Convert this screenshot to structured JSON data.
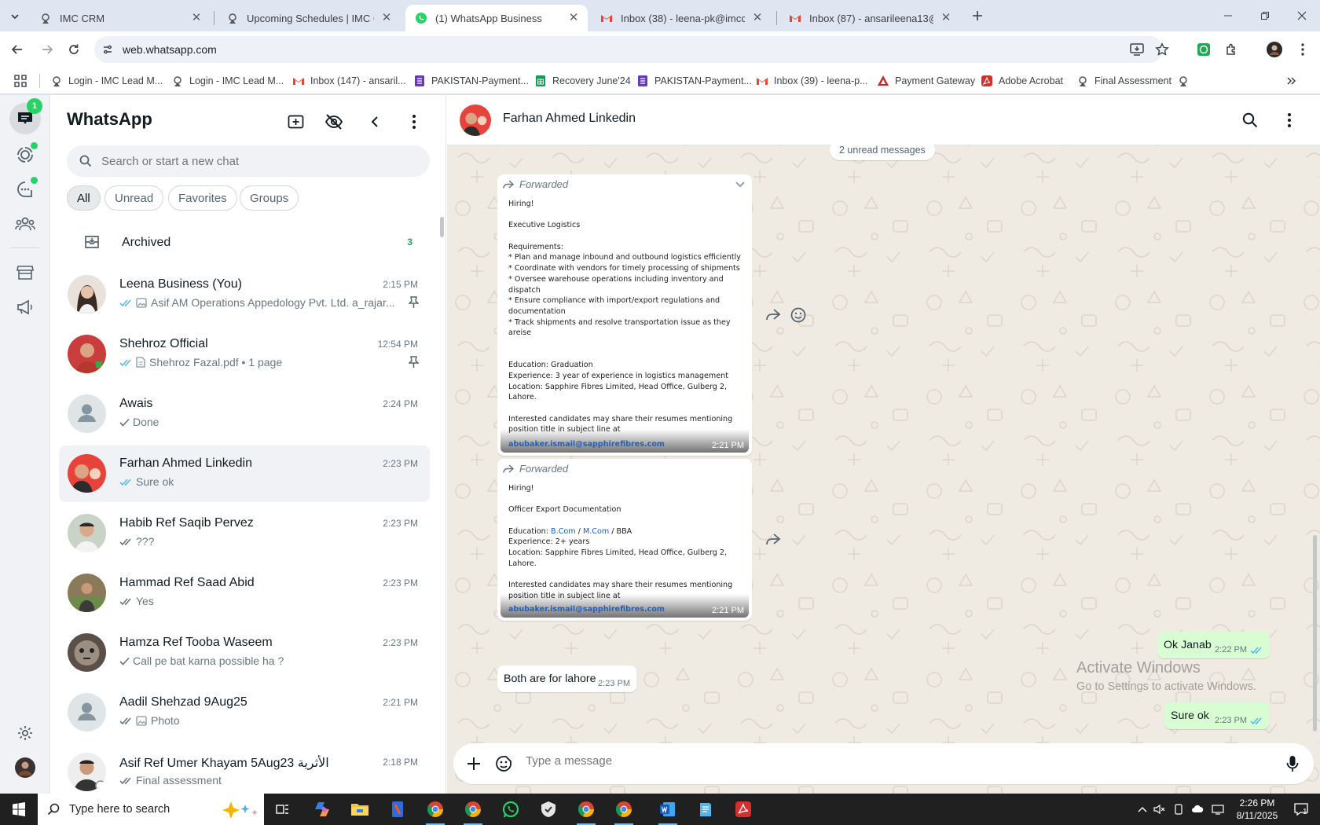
{
  "browser": {
    "tabs": [
      {
        "title": "IMC CRM",
        "active": false
      },
      {
        "title": "Upcoming Schedules | IMC Cer",
        "active": false
      },
      {
        "title": "(1) WhatsApp Business",
        "active": true
      },
      {
        "title": "Inbox (38) - leena-pk@imccerti",
        "active": false
      },
      {
        "title": "Inbox (87) - ansarileena13@gm",
        "active": false
      }
    ],
    "url": "web.whatsapp.com",
    "bookmarks": [
      "Login - IMC Lead M...",
      "Login - IMC Lead M...",
      "Inbox (147) - ansaril...",
      "PAKISTAN-Payment...",
      "Recovery June'24",
      "PAKISTAN-Payment...",
      "Inbox (39) - leena-p...",
      "Payment Gateway",
      "Adobe Acrobat",
      "Final Assessment"
    ]
  },
  "rail": {
    "chats_badge": "1"
  },
  "sidebar": {
    "title": "WhatsApp",
    "search_placeholder": "Search or start a new chat",
    "filters": [
      "All",
      "Unread",
      "Favorites",
      "Groups"
    ],
    "archived_label": "Archived",
    "archived_count": "3",
    "chats": [
      {
        "name": "Leena Business (You)",
        "time": "2:15 PM",
        "preview": "Asif AM Operations Appedology Pvt. Ltd. a_rajar...",
        "tick": "double",
        "media": "photo",
        "pinned": true
      },
      {
        "name": "Shehroz Official",
        "time": "12:54 PM",
        "preview": "Shehroz Fazal.pdf • 1 page",
        "tick": "double",
        "media": "doc",
        "pinned": true
      },
      {
        "name": "Awais",
        "time": "2:24 PM",
        "preview": "Done",
        "tick": "single",
        "media": "",
        "pinned": false
      },
      {
        "name": "Farhan Ahmed Linkedin",
        "time": "2:23 PM",
        "preview": "Sure ok",
        "tick": "double-blue",
        "media": "",
        "pinned": false
      },
      {
        "name": "Habib Ref Saqib Pervez",
        "time": "2:23 PM",
        "preview": "???",
        "tick": "double",
        "media": "",
        "pinned": false
      },
      {
        "name": "Hammad Ref Saad Abid",
        "time": "2:23 PM",
        "preview": "Yes",
        "tick": "double",
        "media": "",
        "pinned": false
      },
      {
        "name": "Hamza Ref Tooba Waseem",
        "time": "2:23 PM",
        "preview": "Call pe bat karna possible ha ?",
        "tick": "single",
        "media": "",
        "pinned": false
      },
      {
        "name": "Aadil Shehzad 9Aug25",
        "time": "2:21 PM",
        "preview": "Photo",
        "tick": "double",
        "media": "photo",
        "pinned": false
      },
      {
        "name": "Asif Ref Umer Khayam 5Aug23 الأثرية",
        "time": "2:18 PM",
        "preview": "Final assessment",
        "tick": "double",
        "media": "",
        "pinned": false
      }
    ]
  },
  "conversation": {
    "contact_name": "Farhan Ahmed Linkedin",
    "unread_label": "2 unread messages",
    "forwarded_label": "Forwarded",
    "card1": {
      "lines": [
        "Hiring!",
        "",
        "Executive Logistics",
        "",
        "Requirements:",
        "* Plan and manage inbound and outbound logistics efficiently",
        "* Coordinate with vendors for timely processing of shipments",
        "* Oversee warehouse operations including inventory and",
        "dispatch",
        "* Ensure compliance with import/export regulations and",
        "documentation",
        "* Track shipments and resolve transportation issue as they",
        "areise",
        "",
        "",
        "Education: Graduation",
        "Experience: 3 year of experience in logistics management",
        "Location: Sapphire Fibres Limited, Head Office, Gulberg 2,",
        "Lahore.",
        "",
        "Interested candidates may share their resumes mentioning",
        "position title in subject line at"
      ],
      "email": "abubaker.ismail@sapphirefibres.com",
      "time": "2:21 PM"
    },
    "card2": {
      "line1": "Hiring!",
      "line2": "Officer Export Documentation",
      "edu_prefix": "Education: ",
      "edu_link1": "B.Com",
      "edu_sep": " / ",
      "edu_link2": "M.Com",
      "edu_suffix": " / BBA",
      "exp": "Experience: 2+ years",
      "loc1": "Location: Sapphire Fibres Limited, Head Office, Gulberg 2,",
      "loc2": "Lahore.",
      "int1": "Interested candidates may share their resumes mentioning",
      "int2": "position title in subject line at",
      "email": "abubaker.ismail@sapphirefibres.com",
      "time": "2:21 PM"
    },
    "messages": [
      {
        "dir": "out",
        "text": "Ok Janab",
        "time": "2:22 PM"
      },
      {
        "dir": "in",
        "text": "Both are for lahore",
        "time": "2:23 PM"
      },
      {
        "dir": "out",
        "text": "Sure ok",
        "time": "2:23 PM"
      }
    ],
    "composer_placeholder": "Type a message",
    "watermark_title": "Activate Windows",
    "watermark_sub": "Go to Settings to activate Windows."
  },
  "taskbar": {
    "search_placeholder": "Type here to search",
    "time": "2:26 PM",
    "date": "8/11/2025",
    "notification_count": "1"
  },
  "colors": {
    "whatsapp_green": "#25d366",
    "read_tick_blue": "#53bdeb",
    "outgoing_bubble": "#d9fdd3",
    "chat_background": "#efeae2"
  }
}
